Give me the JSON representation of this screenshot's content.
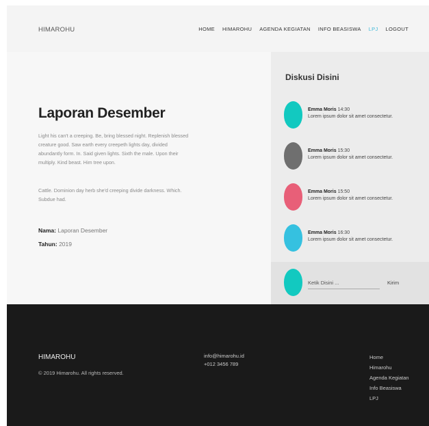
{
  "header": {
    "brand": "HIMAROHU",
    "nav": [
      "HOME",
      "HIMAROHU",
      "AGENDA KEGIATAN",
      "INFO BEASISWA",
      "LPJ",
      "LOGOUT"
    ],
    "active_nav": "LPJ",
    "accent_color": "#3fb9d8"
  },
  "report": {
    "title": "Laporan Desember",
    "paragraph1": "Light his can't a creeping. Be, bring blessed night. Replenish blessed creature good. Saw earth every creepeth lights day, divided abundantly form. In. Said given lights. Sixth the male. Upon their multiply. Kind beast. Him tree upon.",
    "paragraph2": "Cattle. Dominion day herb she'd creeping divide darkness. Which. Subdue had.",
    "nama_label": "Nama:",
    "nama_value": "Laporan Desember",
    "tahun_label": "Tahun:",
    "tahun_value": "2019"
  },
  "discussion": {
    "title": "Diskusi Disini",
    "messages": [
      {
        "author": "Emma Moris",
        "time": "14:30",
        "text": "Lorem ipsum dolor sit amet consectetur.",
        "color": "#12c9c0"
      },
      {
        "author": "Emma Moris",
        "time": "15:30",
        "text": "Lorem ipsum dolor sit amet consectetur.",
        "color": "#6f6f6f"
      },
      {
        "author": "Emma Moris",
        "time": "15:50",
        "text": "Lorem ipsum dolor sit amet consectetur.",
        "color": "#e85f78"
      },
      {
        "author": "Emma Moris",
        "time": "16:30",
        "text": "Lorem ipsum dolor sit amet consectetur.",
        "color": "#35c1e0"
      }
    ],
    "reply": {
      "placeholder": "Ketik Disini ...",
      "send_label": "Kirim",
      "avatar_color": "#12c9c0"
    }
  },
  "footer": {
    "brand": "HIMAROHU",
    "copyright": "© 2019 Himarohu. All rights reserved.",
    "email": "info@himarohu.id",
    "phone": "+012 3456 789",
    "links": [
      "Home",
      "Himarohu",
      "Agenda Kegiatan",
      "Info Beasiswa",
      "LPJ"
    ]
  }
}
